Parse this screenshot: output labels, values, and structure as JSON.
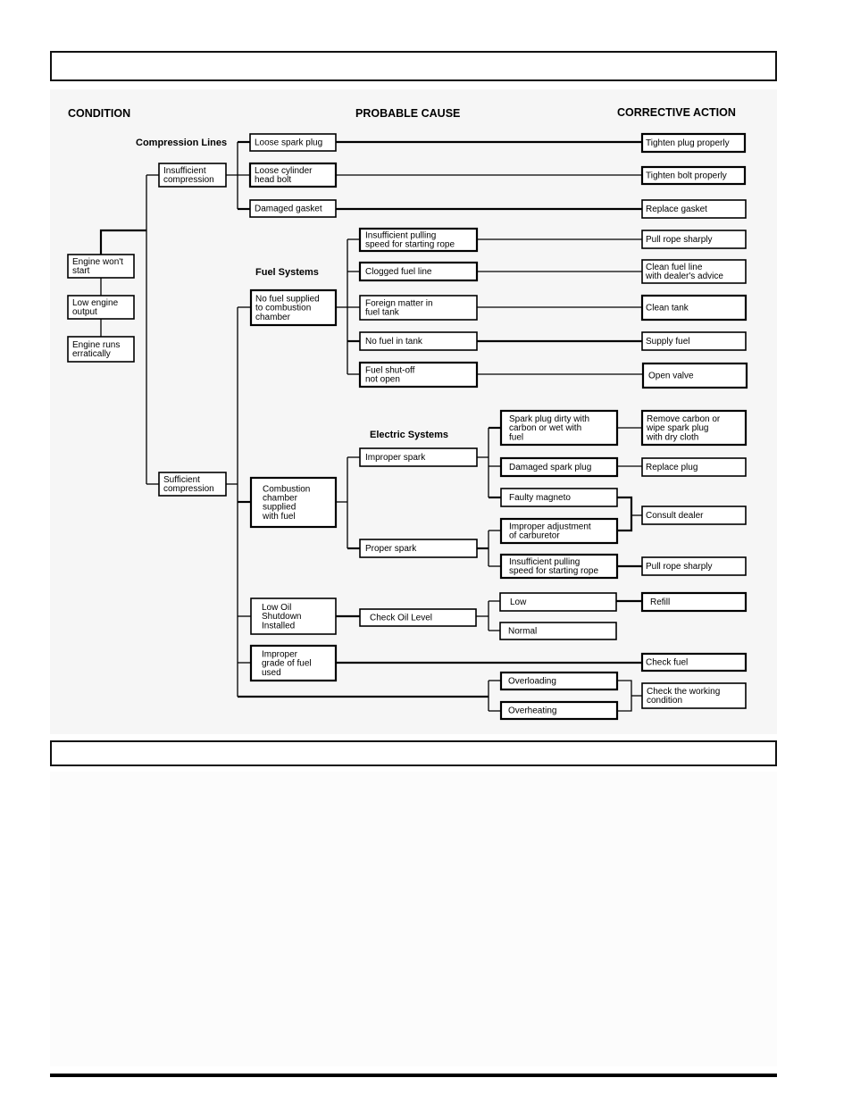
{
  "headers": {
    "condition": "CONDITION",
    "probable_cause": "PROBABLE CAUSE",
    "corrective_action": "CORRECTIVE ACTION"
  },
  "sections": {
    "compression": "Compression Lines",
    "fuel": "Fuel Systems",
    "electric": "Electric Systems"
  },
  "conditions": [
    [
      "Engine won't",
      "start"
    ],
    [
      "Low engine",
      "output"
    ],
    [
      "Engine runs",
      "erratically"
    ]
  ],
  "compression": {
    "insufficient": [
      "Insufficient",
      "compression"
    ],
    "sufficient": [
      "Sufficient",
      "compression"
    ]
  },
  "causes": {
    "loose_spark_plug": [
      "Loose spark plug"
    ],
    "loose_head_bolt": [
      "Loose cylinder",
      "head bolt"
    ],
    "damaged_gasket": [
      "Damaged gasket"
    ],
    "no_fuel_supplied": [
      "No fuel supplied",
      "to combustion",
      "chamber"
    ],
    "insufficient_pulling_fuel": [
      "Insufficient pulling",
      "speed for starting rope"
    ],
    "clogged_fuel_line": [
      "Clogged fuel line"
    ],
    "foreign_matter": [
      "Foreign matter in",
      "fuel tank"
    ],
    "no_fuel_in_tank": [
      "No fuel in tank"
    ],
    "fuel_shutoff": [
      "Fuel shut-off",
      "not open"
    ],
    "combustion_supplied": [
      "Combustion",
      "chamber",
      "supplied",
      "with fuel"
    ],
    "improper_spark": [
      "Improper spark"
    ],
    "proper_spark": [
      "Proper spark"
    ],
    "spark_plug_dirty": [
      "Spark plug dirty with",
      "carbon or wet with",
      "fuel"
    ],
    "damaged_spark_plug": [
      "Damaged spark plug"
    ],
    "faulty_magneto": [
      "Faulty magneto"
    ],
    "improper_carburetor": [
      "Improper adjustment",
      "of carburetor"
    ],
    "insufficient_pulling_elec": [
      "Insufficient pulling",
      "speed for starting rope"
    ],
    "low_oil_shutdown": [
      "Low Oil",
      "Shutdown",
      "Installed"
    ],
    "check_oil_level": [
      "Check Oil Level"
    ],
    "oil_low": [
      "Low"
    ],
    "oil_normal": [
      "Normal"
    ],
    "improper_fuel_grade": [
      "Improper",
      "grade of fuel",
      "used"
    ],
    "overloading": [
      "Overloading"
    ],
    "overheating": [
      "Overheating"
    ]
  },
  "actions": {
    "tighten_plug": [
      "Tighten plug properly"
    ],
    "tighten_bolt": [
      "Tighten bolt properly"
    ],
    "replace_gasket": [
      "Replace gasket"
    ],
    "pull_rope_1": [
      "Pull rope sharply"
    ],
    "clean_fuel_line": [
      "Clean fuel line",
      "with dealer's advice"
    ],
    "clean_tank": [
      "Clean tank"
    ],
    "supply_fuel": [
      "Supply fuel"
    ],
    "open_valve": [
      "Open valve"
    ],
    "remove_carbon": [
      "Remove carbon or",
      "wipe spark plug",
      "with dry cloth"
    ],
    "replace_plug": [
      "Replace plug"
    ],
    "consult_dealer": [
      "Consult dealer"
    ],
    "pull_rope_2": [
      "Pull rope sharply"
    ],
    "refill": [
      "Refill"
    ],
    "check_fuel": [
      "Check fuel"
    ],
    "check_working": [
      "Check the working",
      "condition"
    ]
  }
}
